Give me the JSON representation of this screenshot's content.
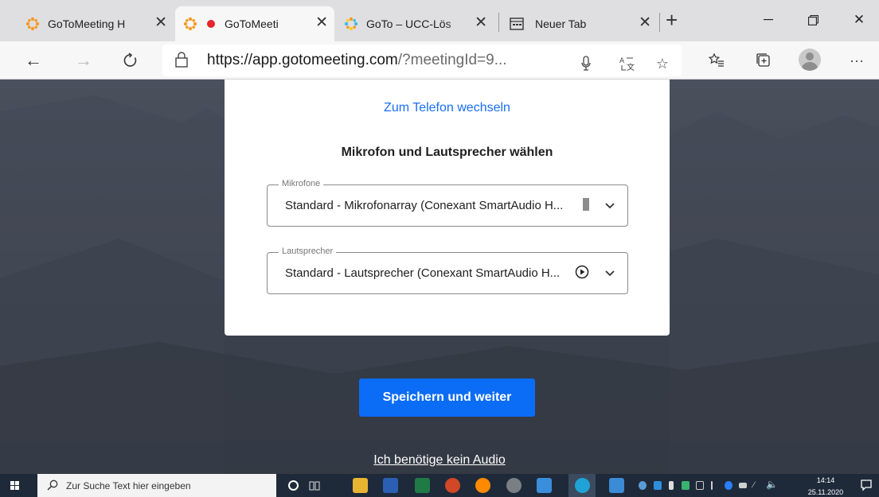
{
  "browser": {
    "tabs": [
      {
        "title": "GoToMeeting H"
      },
      {
        "title": "GoToMeeti"
      },
      {
        "title": "GoTo – UCC-Lös"
      },
      {
        "title": "Neuer Tab"
      }
    ],
    "url_host": "https://app.gotomeeting.com",
    "url_rest": "/?meetingId=9..."
  },
  "dialog": {
    "switch_link": "Zum Telefon wechseln",
    "heading": "Mikrofon und Lautsprecher wählen",
    "microphone": {
      "legend": "Mikrofone",
      "value": "Standard - Mikrofonarray (Conexant SmartAudio H..."
    },
    "speaker": {
      "legend": "Lautsprecher",
      "value": "Standard - Lautsprecher (Conexant SmartAudio H..."
    }
  },
  "actions": {
    "save": "Speichern und weiter",
    "no_audio": "Ich benötige kein Audio"
  },
  "taskbar": {
    "search_placeholder": "Zur Suche Text hier eingeben",
    "time": "14:14",
    "date": "25.11.2020"
  },
  "colors": {
    "accent": "#0b6cf6",
    "link": "#1a6ef5",
    "page_bg": "#3a404a",
    "recording": "#e5242b"
  }
}
